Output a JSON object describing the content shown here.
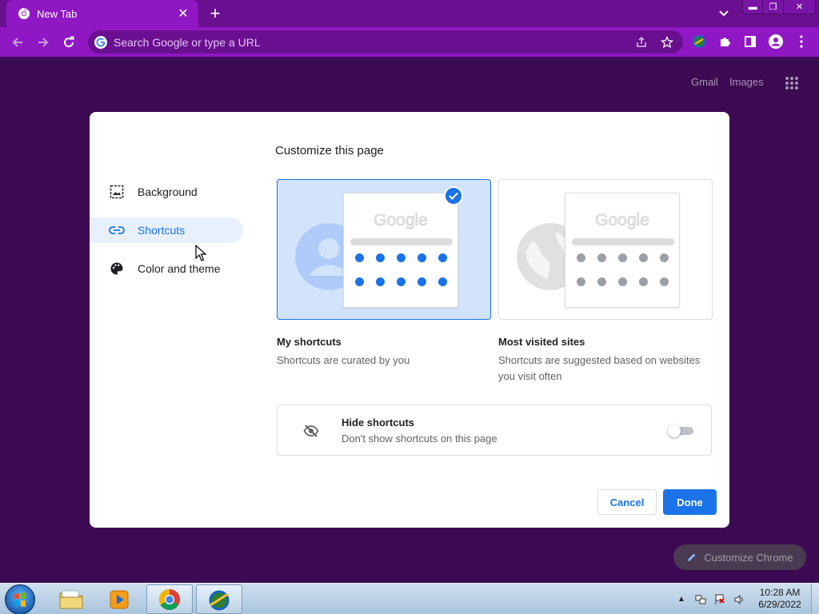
{
  "browser": {
    "tab_title": "New Tab",
    "tab_close": "✕",
    "new_tab": "+",
    "window_buttons": {
      "minimize": "▬",
      "restore": "❐",
      "close": "✕"
    },
    "omnibox_placeholder": "Search Google or type a URL"
  },
  "ntp": {
    "links": [
      "Gmail",
      "Images"
    ],
    "customize_chrome_label": "Customize Chrome"
  },
  "dialog": {
    "title": "Customize this page",
    "sidebar": [
      {
        "label": "Background",
        "icon": "image-icon",
        "active": false
      },
      {
        "label": "Shortcuts",
        "icon": "link-icon",
        "active": true
      },
      {
        "label": "Color and theme",
        "icon": "palette-icon",
        "active": false
      }
    ],
    "options": [
      {
        "label": "My shortcuts",
        "description": "Shortcuts are curated by you",
        "logo": "Google",
        "selected": true
      },
      {
        "label": "Most visited sites",
        "description": "Shortcuts are suggested based on websites you visit often",
        "logo": "Google",
        "selected": false
      }
    ],
    "hide_shortcuts": {
      "title": "Hide shortcuts",
      "description": "Don't show shortcuts on this page",
      "enabled": false
    },
    "cancel_label": "Cancel",
    "done_label": "Done"
  },
  "taskbar": {
    "time": "10:28 AM",
    "date": "6/29/2022"
  },
  "colors": {
    "accent": "#1a73e8",
    "frame": "#6a0f90",
    "toolbar": "#8f18c4",
    "ntp_background": "#3c0a52"
  }
}
